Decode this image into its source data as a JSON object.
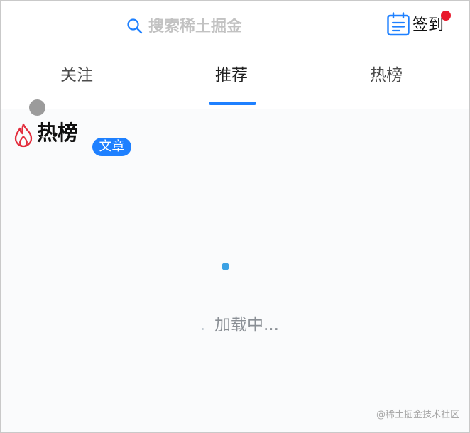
{
  "header": {
    "search": {
      "placeholder": "搜索稀土掘金",
      "icon": "search-icon"
    },
    "checkin": {
      "label": "签到",
      "icon": "calendar-icon",
      "has_notification": true
    }
  },
  "tabs": [
    {
      "label": "关注",
      "active": false
    },
    {
      "label": "推荐",
      "active": true
    },
    {
      "label": "热榜",
      "active": false
    }
  ],
  "hot_banner": {
    "icon": "flame-icon",
    "title": "热榜",
    "tag": "文章"
  },
  "loading": {
    "text": "加载中..."
  },
  "watermark": "@稀土掘金技术社区",
  "colors": {
    "accent": "#1e80ff",
    "notification": "#e8192c",
    "flame": "#e32d3d",
    "loading_dot": "#3ba1e4"
  }
}
